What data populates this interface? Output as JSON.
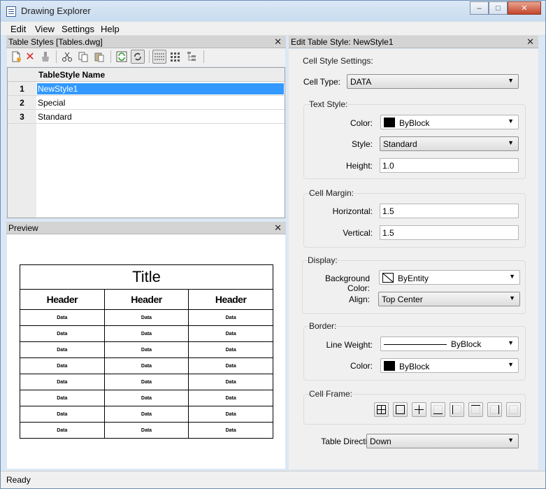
{
  "window": {
    "title": "Drawing Explorer",
    "controls": {
      "minimize": "–",
      "maximize": "□",
      "close": "✕"
    }
  },
  "menu": [
    "Edit",
    "View",
    "Settings",
    "Help"
  ],
  "left_pane": {
    "title": "Table Styles [Tables.dwg]",
    "close": "✕",
    "toolbar_icons": [
      "new-icon",
      "delete-icon",
      "purge-icon",
      "cut-icon",
      "copy-icon",
      "paste-icon",
      "refresh-icon",
      "sync-icon",
      "details-view-icon",
      "icons-view-icon",
      "tree-view-icon"
    ],
    "grid": {
      "column_header": "TableStyle Name",
      "rows": [
        {
          "num": "1",
          "name": "NewStyle1",
          "selected": true
        },
        {
          "num": "2",
          "name": "Special"
        },
        {
          "num": "3",
          "name": "Standard"
        }
      ]
    }
  },
  "preview_pane": {
    "title": "Preview",
    "close": "✕",
    "table": {
      "title": "Title",
      "headers": [
        "Header",
        "Header",
        "Header"
      ],
      "data_cell": "Data",
      "data_rows": 8
    }
  },
  "edit_pane": {
    "title": "Edit Table Style: NewStyle1",
    "close": "✕",
    "cell_style_settings": "Cell Style Settings:",
    "cell_type_label": "Cell Type:",
    "cell_type_value": "DATA",
    "text_style": {
      "label": "Text Style:",
      "color_label": "Color:",
      "color_value": "ByBlock",
      "style_label": "Style:",
      "style_value": "Standard",
      "height_label": "Height:",
      "height_value": "1.0"
    },
    "cell_margin": {
      "label": "Cell Margin:",
      "horizontal_label": "Horizontal:",
      "horizontal_value": "1.5",
      "vertical_label": "Vertical:",
      "vertical_value": "1.5"
    },
    "display": {
      "label": "Display:",
      "bg_color_label": "Background Color:",
      "bg_color_value": "ByEntity",
      "align_label": "Align:",
      "align_value": "Top Center"
    },
    "border": {
      "label": "Border:",
      "line_weight_label": "Line Weight:",
      "line_weight_value": "ByBlock",
      "color_label": "Color:",
      "color_value": "ByBlock"
    },
    "cell_frame": {
      "label": "Cell Frame:",
      "buttons": [
        "all-borders-icon",
        "outside-borders-icon",
        "inside-borders-icon",
        "bottom-border-icon",
        "left-border-icon",
        "top-border-icon",
        "right-border-icon",
        "no-border-icon"
      ]
    },
    "table_direction_label": "Table Direction:",
    "table_direction_value": "Down"
  },
  "status": "Ready",
  "colors": {
    "selection": "#3399ff",
    "pane_header": "#d4d4d4"
  }
}
